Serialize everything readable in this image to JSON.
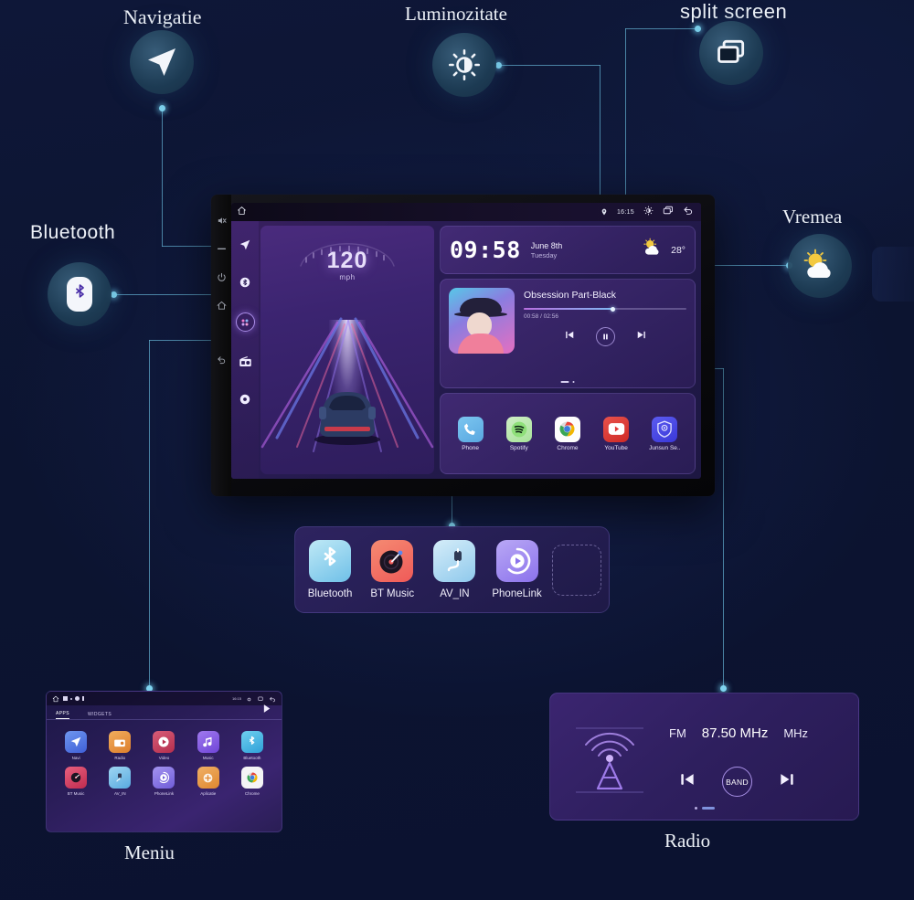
{
  "callouts": {
    "navigation": {
      "label": "Navigatie",
      "icon": "navigation-arrow-icon"
    },
    "brightness": {
      "label": "Luminozitate",
      "icon": "brightness-icon"
    },
    "split_screen": {
      "label": "split screen",
      "icon": "split-screen-icon"
    },
    "bluetooth": {
      "label": "Bluetooth",
      "icon": "bluetooth-icon"
    },
    "weather": {
      "label": "Vremea",
      "icon": "sun-cloud-icon"
    },
    "menu": {
      "label": "Meniu"
    },
    "radio": {
      "label": "Radio"
    }
  },
  "head_unit": {
    "status_bar": {
      "home_icon": "home-icon",
      "location_icon": "location-pin-icon",
      "time": "16:15",
      "brightness_icon": "brightness-icon",
      "split_icon": "split-screen-icon",
      "back_icon": "back-arrow-icon"
    },
    "sidebar": [
      {
        "name": "navigation",
        "icon": "navigation-arrow-icon",
        "active": false
      },
      {
        "name": "bluetooth",
        "icon": "bluetooth-icon",
        "active": false
      },
      {
        "name": "apps",
        "icon": "apps-grid-icon",
        "active": true
      },
      {
        "name": "radio",
        "icon": "radio-icon",
        "active": false
      },
      {
        "name": "settings",
        "icon": "settings-gear-icon",
        "active": false
      }
    ],
    "speedometer": {
      "value": "120",
      "unit": "mph"
    },
    "clock_card": {
      "time": "09:58",
      "date": "June 8th",
      "weekday": "Tuesday",
      "weather_icon": "sun-cloud-icon",
      "temperature": "28°"
    },
    "music_card": {
      "title": "Obsession Part-Black",
      "elapsed": "00:58",
      "duration": "02:56",
      "time_display": "00:58 / 02:56",
      "progress_percent": 55,
      "prev_icon": "skip-previous-icon",
      "play_icon": "pause-icon",
      "next_icon": "skip-next-icon"
    },
    "apps": [
      {
        "label": "Phone",
        "icon": "phone-icon",
        "color": "#67b5e8"
      },
      {
        "label": "Spotify",
        "icon": "spotify-icon",
        "color": "#6fd47f"
      },
      {
        "label": "Chrome",
        "icon": "chrome-icon",
        "color": "#ffffff"
      },
      {
        "label": "YouTube",
        "icon": "youtube-icon",
        "color": "#e03a38"
      },
      {
        "label": "Junsun Se..",
        "icon": "junsun-shield-icon",
        "color": "#4d59e8"
      }
    ]
  },
  "app_tray": {
    "items": [
      {
        "label": "Bluetooth",
        "icon": "bluetooth-icon"
      },
      {
        "label": "BT Music",
        "icon": "vinyl-record-icon"
      },
      {
        "label": "AV_IN",
        "icon": "av-cable-icon"
      },
      {
        "label": "PhoneLink",
        "icon": "phonelink-play-icon"
      }
    ],
    "empty_slot": "empty-app-slot"
  },
  "menu_screen": {
    "status": {
      "home_icon": "home-icon",
      "time": "16:15"
    },
    "tabs": [
      {
        "label": "APPS",
        "active": true
      },
      {
        "label": "WIDGETS",
        "active": false
      }
    ],
    "play_icon": "play-store-icon",
    "apps": [
      {
        "label": "Navi",
        "icon": "navigation-arrow-icon",
        "color": "#4e7ce8"
      },
      {
        "label": "Radio",
        "icon": "radio-icon",
        "color": "#e8903a"
      },
      {
        "label": "Video",
        "icon": "video-play-icon",
        "color": "#c2405e"
      },
      {
        "label": "Music",
        "icon": "music-note-icon",
        "color": "#8a5de0"
      },
      {
        "label": "Bluetooth",
        "icon": "bluetooth-icon",
        "color": "#3fb8e8"
      },
      {
        "label": "BT Music",
        "icon": "vinyl-record-icon",
        "color": "#d8415e"
      },
      {
        "label": "AV_IN",
        "icon": "av-cable-icon",
        "color": "#4aa9e8"
      },
      {
        "label": "PhoneLink",
        "icon": "phonelink-play-icon",
        "color": "#7b6ce0"
      },
      {
        "label": "Aplicatie",
        "icon": "apps-folder-icon",
        "color": "#e8913a"
      },
      {
        "label": "Chrome",
        "icon": "chrome-icon",
        "color": "#f2f2f2"
      }
    ]
  },
  "radio_screen": {
    "tower_icon": "radio-tower-icon",
    "band": "FM",
    "frequency": "87.50 MHz",
    "unit": "MHz",
    "prev_icon": "skip-previous-icon",
    "band_button": "BAND",
    "next_icon": "skip-next-icon"
  },
  "colors": {
    "background": "#0c1430",
    "connector": "#5fa8c9",
    "dot": "#7fd4ef",
    "bubble": "#24506f"
  }
}
